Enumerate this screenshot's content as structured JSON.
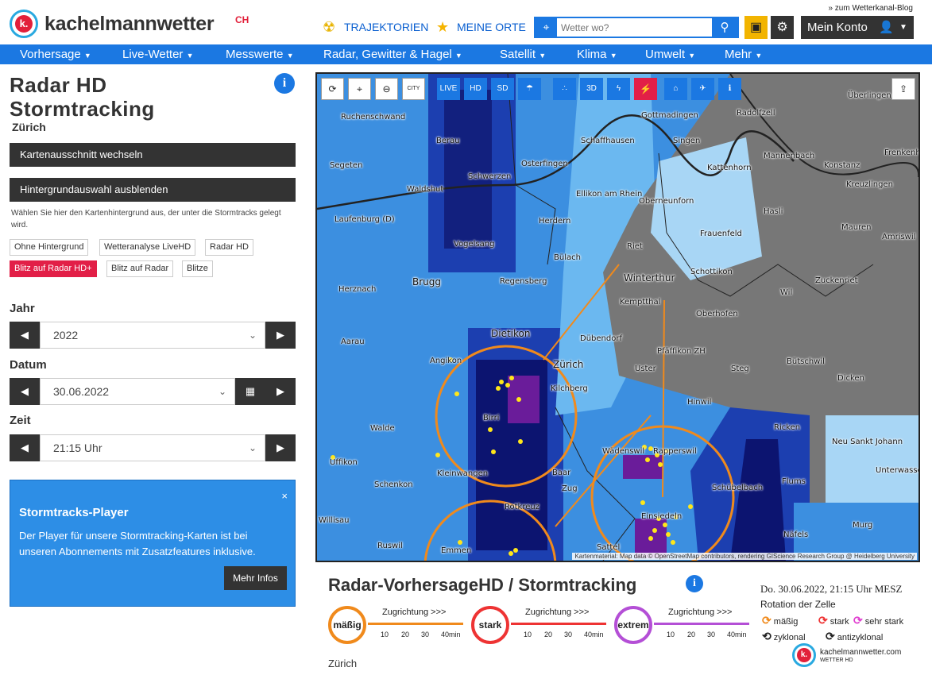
{
  "header": {
    "logo_letter": "k.",
    "logo_text": "kachelmannwetter",
    "logo_sup": "CH",
    "blog_link": "» zum Wetterkanal-Blog",
    "trajektorien": "TRAJEKTORIEN",
    "meine_orte": "MEINE ORTE",
    "search_placeholder": "Wetter wo?",
    "account": "Mein Konto"
  },
  "nav": [
    "Vorhersage",
    "Live-Wetter",
    "Messwerte",
    "Radar, Gewitter & Hagel",
    "Satellit",
    "Klima",
    "Umwelt",
    "Mehr"
  ],
  "sidebar": {
    "title": "Radar HD Stormtracking",
    "location": "Zürich",
    "btn_ausschnitt": "Kartenausschnitt wechseln",
    "btn_hintergrund": "Hintergrundauswahl ausblenden",
    "hint": "Wählen Sie hier den Kartenhintergrund aus, der unter die Stormtracks gelegt wird.",
    "backgrounds": [
      "Ohne Hintergrund",
      "Wetteranalyse LiveHD",
      "Radar HD",
      "Blitz auf Radar HD+",
      "Blitz auf Radar",
      "Blitze"
    ],
    "active_background": "Blitz auf Radar HD+",
    "jahr_label": "Jahr",
    "jahr_value": "2022",
    "datum_label": "Datum",
    "datum_value": "30.06.2022",
    "zeit_label": "Zeit",
    "zeit_value": "21:15 Uhr"
  },
  "player": {
    "title": "Stormtracks-Player",
    "text": "Der Player für unsere Stormtracking-Karten ist bei unseren Abonnements mit Zusatzfeatures inklusive.",
    "button": "Mehr Infos",
    "close": "×"
  },
  "map": {
    "toolbar": [
      "refresh-icon",
      "location-pin-icon",
      "zoom-out-icon",
      "city-icon",
      "live-icon",
      "hd-icon",
      "sd-icon",
      "rain-icon",
      "dots-icon",
      "3d-icon",
      "lightning-icon",
      "no-lightning-icon",
      "home-icon",
      "satellite-icon",
      "info-icon"
    ],
    "toolbar_labels": {
      "city": "CITY",
      "live": "LIVE",
      "hd": "HD",
      "sd": "SD",
      "3d": "3D"
    },
    "attribution": "Kartenmaterial: Map data © OpenStreetMap contributors, rendering GIScience Research Group @ Heidelberg University",
    "cities": [
      {
        "name": "Ruchenschwand"
      },
      {
        "name": "Berau"
      },
      {
        "name": "Gottmadingen"
      },
      {
        "name": "Radolfzell"
      },
      {
        "name": "Überlingen"
      },
      {
        "name": "Schaffhausen"
      },
      {
        "name": "Singen"
      },
      {
        "name": "Segeten"
      },
      {
        "name": "Osterfingen"
      },
      {
        "name": "Mannenbach"
      },
      {
        "name": "Frenkenhausen"
      },
      {
        "name": "Konstanz"
      },
      {
        "name": "Kattenhorn"
      },
      {
        "name": "Schwerzen"
      },
      {
        "name": "Ellikon am Rhein"
      },
      {
        "name": "Kreuzlingen"
      },
      {
        "name": "Waldshut"
      },
      {
        "name": "Oberneunforn"
      },
      {
        "name": "Hasli"
      },
      {
        "name": "Laufenburg (D)"
      },
      {
        "name": "Herdern"
      },
      {
        "name": "Mauren"
      },
      {
        "name": "Frauenfeld"
      },
      {
        "name": "Amriswil"
      },
      {
        "name": "Vogelsang"
      },
      {
        "name": "Riet"
      },
      {
        "name": "Bülach"
      },
      {
        "name": "Brugg"
      },
      {
        "name": "Regensberg"
      },
      {
        "name": "Winterthur"
      },
      {
        "name": "Schottikon"
      },
      {
        "name": "Zuckenriet"
      },
      {
        "name": "Herznach"
      },
      {
        "name": "Kemptthal"
      },
      {
        "name": "Wil"
      },
      {
        "name": "Oberhofen"
      },
      {
        "name": "Dietikon"
      },
      {
        "name": "Aarau"
      },
      {
        "name": "Dübendorf"
      },
      {
        "name": "Pfäffikon ZH"
      },
      {
        "name": "Bütschwil"
      },
      {
        "name": "Angikon"
      },
      {
        "name": "Zürich"
      },
      {
        "name": "Uster"
      },
      {
        "name": "Steg"
      },
      {
        "name": "Kilchberg"
      },
      {
        "name": "Dicken"
      },
      {
        "name": "Hinwil"
      },
      {
        "name": "Birri"
      },
      {
        "name": "Ricken"
      },
      {
        "name": "Walde"
      },
      {
        "name": "Neu Sankt Johann"
      },
      {
        "name": "Uffikon"
      },
      {
        "name": "Wädenswil"
      },
      {
        "name": "Rapperswil"
      },
      {
        "name": "Kleinwangen"
      },
      {
        "name": "Baar"
      },
      {
        "name": "Schübelbach"
      },
      {
        "name": "Unterwasser"
      },
      {
        "name": "Schenkon"
      },
      {
        "name": "Zug"
      },
      {
        "name": "Rotkreuz"
      },
      {
        "name": "Einsiedeln"
      },
      {
        "name": "Willisau"
      },
      {
        "name": "Murg"
      },
      {
        "name": "Näfels"
      },
      {
        "name": "Ruswil"
      },
      {
        "name": "Emmen"
      },
      {
        "name": "Sattel"
      },
      {
        "name": "Flums"
      }
    ]
  },
  "legend": {
    "title": "Radar-VorhersageHD / Stormtracking",
    "datestamp": "Do. 30.06.2022, 21:15 Uhr MESZ",
    "rotation_title": "Rotation der Zelle",
    "zugrichtung": "Zugrichtung >>>",
    "ticks": [
      "10",
      "20",
      "30",
      "40min"
    ],
    "classes": [
      {
        "label": "mäßig",
        "color": "#f08a1c"
      },
      {
        "label": "stark",
        "color": "#ee3333"
      },
      {
        "label": "extrem",
        "color": "#b44fd6"
      }
    ],
    "rotation": [
      {
        "label": "mäßig",
        "color": "#f08a1c"
      },
      {
        "label": "stark",
        "color": "#ee3333"
      },
      {
        "label": "sehr stark",
        "color": "#e03fd0"
      },
      {
        "label": "zyklonal",
        "color": "#111111"
      },
      {
        "label": "antizyklonal",
        "color": "#111111"
      }
    ],
    "location": "Zürich",
    "brand": "kachelmannwetter.com",
    "brand_sub": "WETTER HD"
  }
}
